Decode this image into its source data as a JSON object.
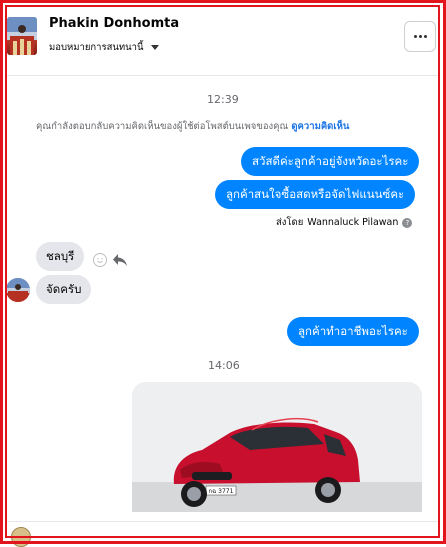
{
  "header": {
    "name": "Phakin Donhomta",
    "subtitle": "มอบหมายการสนทนานี้"
  },
  "thread": {
    "time_1": "12:39",
    "info_text": "คุณกำลังตอบกลับความคิดเห็นของผู้ใช้ต่อโพสต์บนเพจของคุณ",
    "info_link": "ดูความคิดเห็น",
    "outgoing_1": "สวัสดีค่ะลูกค้าอยู่จังหวัดอะไรคะ",
    "outgoing_2": "ลูกค้าสนใจซื้อสดหรือจัดไฟแนนซ์คะ",
    "sent_by_label": "ส่งโดย",
    "sent_by_name": "Wannaluck Pilawan",
    "help_glyph": "?",
    "incoming_1": "ชลบุรี",
    "incoming_2": "จัดครับ",
    "outgoing_3": "ลูกค้าทำอาชีพอะไรคะ",
    "time_2": "14:06",
    "plate_text": "กฉ 3771"
  },
  "colors": {
    "accent": "#0084ff",
    "link": "#1b74e4",
    "border_highlight": "#e3151c",
    "bubble_in": "#e4e6eb",
    "car_red": "#c8102e"
  },
  "icons": {
    "more": "more-dots-icon",
    "dropdown": "chevron-down-icon",
    "react": "smiley-icon",
    "reply": "reply-arrow-icon",
    "help": "help-icon"
  }
}
